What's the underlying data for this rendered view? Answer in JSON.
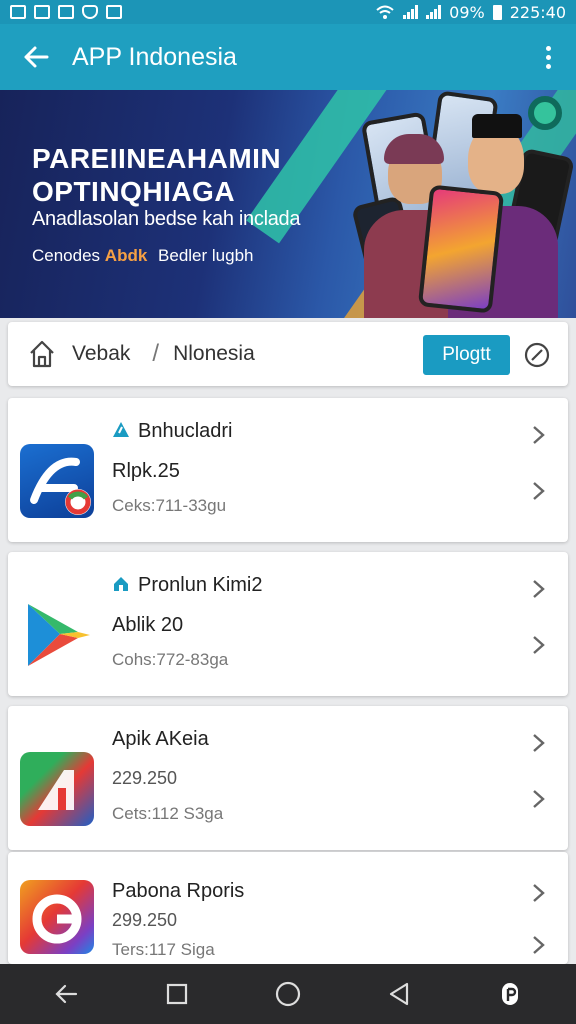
{
  "status_bar": {
    "battery_percent": "09%",
    "time": "225:40"
  },
  "app_bar": {
    "title": "APP Indonesia"
  },
  "banner": {
    "headline_line1": "PAREIINEAHAMIN",
    "headline_line2": "OPTINQHIAGA",
    "subtitle": "Anadlasolan bedse kah inclada",
    "tagline_prefix": "Cenodes",
    "tagline_accent": "Abdk",
    "tagline_suffix": "Bedler lugbh"
  },
  "breadcrumb": {
    "home": "Vebak",
    "separator": "/",
    "current": "Nlonesia",
    "action_label": "Plogtt"
  },
  "apps": [
    {
      "title": "Bnhucladri",
      "version": "Rlpk.25",
      "meta": "Ceks:711-33gu",
      "badge_color": "#1a9bc2"
    },
    {
      "title": "Pronlun Kimi2",
      "version": "Ablik 20",
      "meta": "Cohs:772-83ga",
      "badge_color": "#1a9bc2"
    },
    {
      "title": "Apik AKeia",
      "version": "229.250",
      "meta": "Cets:112 S3ga"
    },
    {
      "title": "Pabona Rporis",
      "version": "299.250",
      "meta": "Ters:117 Siga"
    }
  ],
  "colors": {
    "accent": "#1f9fc0",
    "cta": "#1a9bc2",
    "nav": "#2a2a2c"
  }
}
